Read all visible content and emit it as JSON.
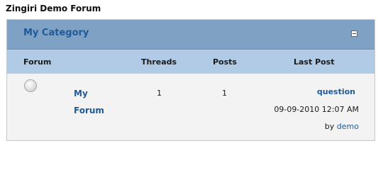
{
  "page": {
    "title": "Zingiri Demo Forum"
  },
  "category": {
    "title": "My Category",
    "collapse_icon": "minus-box-icon"
  },
  "columns": {
    "forum": "Forum",
    "threads": "Threads",
    "posts": "Posts",
    "last_post": "Last Post"
  },
  "forums": [
    {
      "status_icon": "no-new-posts-icon",
      "name_line1": "My",
      "name_line2": "Forum",
      "threads": "1",
      "posts": "1",
      "last_post": {
        "title": "question",
        "datetime": "09-09-2010 12:07 AM",
        "by_prefix": "by",
        "author": "demo"
      }
    }
  ],
  "colors": {
    "category_bar": "#7fa1c3",
    "header_row": "#b1cbe6",
    "data_row": "#f3f3f3",
    "link": "#1e5a9a"
  }
}
